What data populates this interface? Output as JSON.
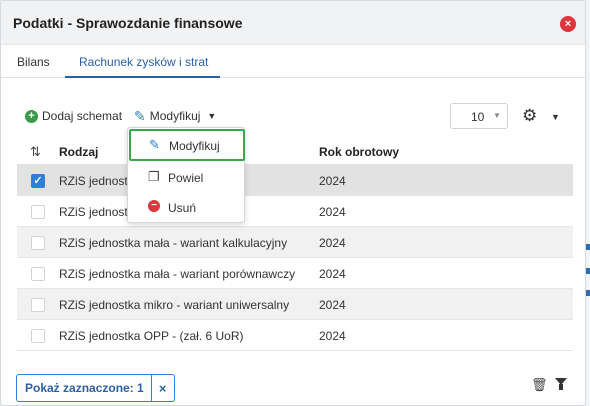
{
  "header": {
    "title": "Podatki - Sprawozdanie finansowe",
    "close_icon": "×"
  },
  "tabs": [
    {
      "label": "Bilans",
      "active": false
    },
    {
      "label": "Rachunek zysków i strat",
      "active": true
    }
  ],
  "toolbar": {
    "add_label": "Dodaj schemat",
    "modify_label": "Modyfikuj",
    "page_size": "10",
    "settings_icon": "cogs-icon"
  },
  "table": {
    "columns": [
      "Rodzaj",
      "Rok obrotowy"
    ],
    "rows": [
      {
        "rodzaj": "RZiS jednostka inna - wariant kalkulacyjny",
        "rok": "2024",
        "checked": true
      },
      {
        "rodzaj": "RZiS jednostka inna - wariant porównawczy",
        "rok": "2024",
        "checked": false
      },
      {
        "rodzaj": "RZiS jednostka mała - wariant kalkulacyjny",
        "rok": "2024",
        "checked": false
      },
      {
        "rodzaj": "RZiS jednostka mała - wariant porównawczy",
        "rok": "2024",
        "checked": false
      },
      {
        "rodzaj": "RZiS jednostka mikro - wariant uniwersalny",
        "rok": "2024",
        "checked": false
      },
      {
        "rodzaj": "RZiS jednostka OPP - (zał. 6 UoR)",
        "rok": "2024",
        "checked": false
      }
    ],
    "visible_rodzaj": [
      "RZiS jednostk",
      "RZiS jednostk"
    ]
  },
  "dropdown": {
    "items": [
      {
        "label": "Modyfikuj",
        "icon": "edit-icon"
      },
      {
        "label": "Powiel",
        "icon": "copy-icon"
      },
      {
        "label": "Usuń",
        "icon": "minus-circle-icon"
      }
    ]
  },
  "footer": {
    "filter_label": "Pokaż zaznaczone: 1",
    "filter_clear": "×"
  },
  "colors": {
    "accent": "#2f7fd6",
    "tab_active": "#2b5fa6",
    "add": "#3a9a48",
    "danger": "#e0343e",
    "focus": "#3aa84f"
  }
}
